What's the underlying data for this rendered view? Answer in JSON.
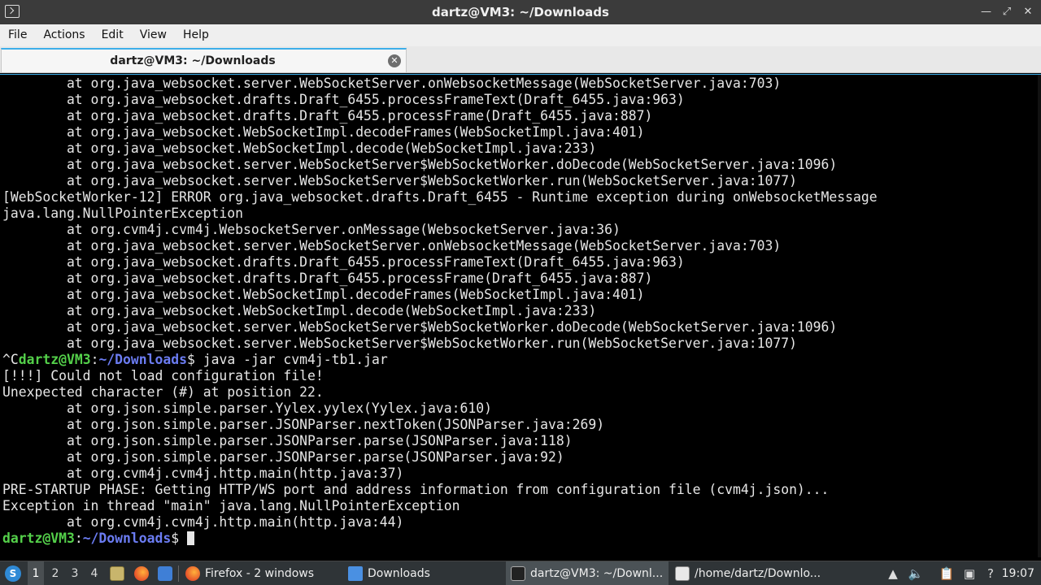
{
  "window": {
    "title": "dartz@VM3: ~/Downloads",
    "min_icon": "minimize-icon",
    "max_icon": "maximize-icon",
    "close_icon": "close-icon"
  },
  "menu": [
    "File",
    "Actions",
    "Edit",
    "View",
    "Help"
  ],
  "tab": {
    "label": "dartz@VM3: ~/Downloads",
    "close_icon": "tab-close-icon"
  },
  "colors": {
    "accent": "#3daee9",
    "prompt_user": "#54d04a",
    "prompt_path": "#6b7cf2"
  },
  "terminal": {
    "lines": [
      "        at org.java_websocket.server.WebSocketServer.onWebsocketMessage(WebSocketServer.java:703)",
      "        at org.java_websocket.drafts.Draft_6455.processFrameText(Draft_6455.java:963)",
      "        at org.java_websocket.drafts.Draft_6455.processFrame(Draft_6455.java:887)",
      "        at org.java_websocket.WebSocketImpl.decodeFrames(WebSocketImpl.java:401)",
      "        at org.java_websocket.WebSocketImpl.decode(WebSocketImpl.java:233)",
      "        at org.java_websocket.server.WebSocketServer$WebSocketWorker.doDecode(WebSocketServer.java:1096)",
      "        at org.java_websocket.server.WebSocketServer$WebSocketWorker.run(WebSocketServer.java:1077)",
      "[WebSocketWorker-12] ERROR org.java_websocket.drafts.Draft_6455 - Runtime exception during onWebsocketMessage",
      "java.lang.NullPointerException",
      "        at org.cvm4j.cvm4j.WebsocketServer.onMessage(WebsocketServer.java:36)",
      "        at org.java_websocket.server.WebSocketServer.onWebsocketMessage(WebSocketServer.java:703)",
      "        at org.java_websocket.drafts.Draft_6455.processFrameText(Draft_6455.java:963)",
      "        at org.java_websocket.drafts.Draft_6455.processFrame(Draft_6455.java:887)",
      "        at org.java_websocket.WebSocketImpl.decodeFrames(WebSocketImpl.java:401)",
      "        at org.java_websocket.WebSocketImpl.decode(WebSocketImpl.java:233)",
      "        at org.java_websocket.server.WebSocketServer$WebSocketWorker.doDecode(WebSocketServer.java:1096)",
      "        at org.java_websocket.server.WebSocketServer$WebSocketWorker.run(WebSocketServer.java:1077)"
    ],
    "prompt_cmd": {
      "prefix": "^C",
      "user": "dartz@VM3",
      "sep": ":",
      "path": "~/Downloads",
      "dollar": "$",
      "command": " java -jar cvm4j-tb1.jar"
    },
    "lines2": [
      "[!!!] Could not load configuration file!",
      "Unexpected character (#) at position 22.",
      "        at org.json.simple.parser.Yylex.yylex(Yylex.java:610)",
      "        at org.json.simple.parser.JSONParser.nextToken(JSONParser.java:269)",
      "        at org.json.simple.parser.JSONParser.parse(JSONParser.java:118)",
      "        at org.json.simple.parser.JSONParser.parse(JSONParser.java:92)",
      "        at org.cvm4j.cvm4j.http.main(http.java:37)",
      "PRE-STARTUP PHASE: Getting HTTP/WS port and address information from configuration file (cvm4j.json)...",
      "Exception in thread \"main\" java.lang.NullPointerException",
      "        at org.cvm4j.cvm4j.http.main(http.java:44)"
    ],
    "prompt_final": {
      "user": "dartz@VM3",
      "sep": ":",
      "path": "~/Downloads",
      "dollar": "$"
    }
  },
  "taskbar": {
    "start_icon": "start-menu-icon",
    "desktops": [
      "1",
      "2",
      "3",
      "4"
    ],
    "active_desktop": "1",
    "quicklaunch": [
      "file-manager-icon",
      "firefox-icon",
      "show-desktop-icon"
    ],
    "tasks": [
      {
        "icon": "firefox-icon",
        "label": "Firefox - 2 windows"
      },
      {
        "icon": "folder-icon",
        "label": "Downloads"
      },
      {
        "icon": "terminal-icon",
        "label": "dartz@VM3: ~/Downl..."
      },
      {
        "icon": "text-editor-icon",
        "label": "/home/dartz/Downlo..."
      }
    ],
    "tray": [
      "tray-up-icon",
      "volume-icon",
      "clipboard-icon",
      "network-icon",
      "help-icon"
    ],
    "clock": "19:07"
  }
}
